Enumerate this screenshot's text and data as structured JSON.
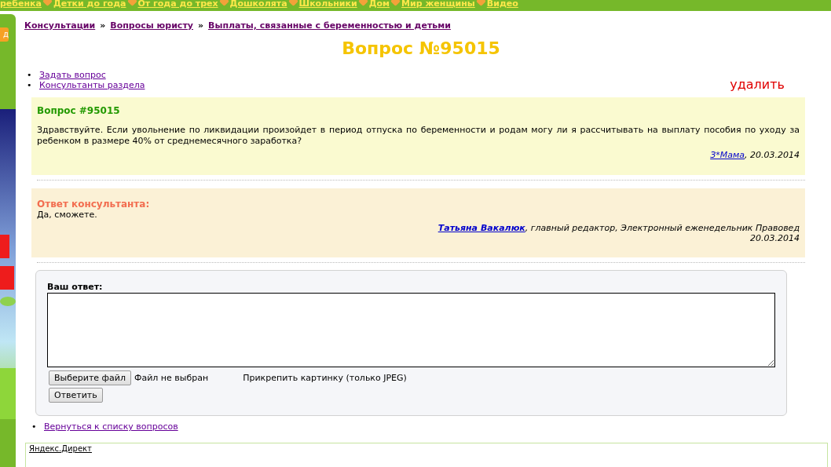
{
  "top_nav": [
    "ребенка",
    "Детки до года",
    "От года до трех",
    "Дошколята",
    "Школьники",
    "Дом",
    "Мир женщины",
    "Видео"
  ],
  "side_button": "д",
  "breadcrumbs": [
    "Консультации",
    "Вопросы юристу",
    "Выплаты, связанные с беременностью и детьми"
  ],
  "breadcrumb_separator": "»",
  "page_title": "Вопрос №95015",
  "bullet": "•",
  "links": [
    "Задать вопрос",
    "Консультанты раздела"
  ],
  "delete_link": "удалить",
  "question": {
    "title": "Вопрос #95015",
    "text": "Здравствуйте. Если увольнение по ликвидации произойдет в период отпуска по беременности и родам могу ли я рассчитывать на выплату пособия по уходу за ребенком в размере 40% от среднемесячного заработка?",
    "author": "З*Мама",
    "date": ", 20.03.2014"
  },
  "answer": {
    "heading": "Ответ консультанта:",
    "text": "Да, сможете.",
    "author": "Татьяна Вакалюк",
    "role": ", главный редактор, Электронный еженедельник Правовед",
    "date": "20.03.2014"
  },
  "reply_form": {
    "label": "Ваш ответ:",
    "file_button": "Выберите файл",
    "file_status": "Файл не выбран",
    "attach_hint": "Прикрепить картинку (только JPEG)",
    "submit": "Ответить"
  },
  "back_link": "Вернуться к списку вопросов",
  "ad_block": {
    "title": "Яндекс.Директ"
  }
}
